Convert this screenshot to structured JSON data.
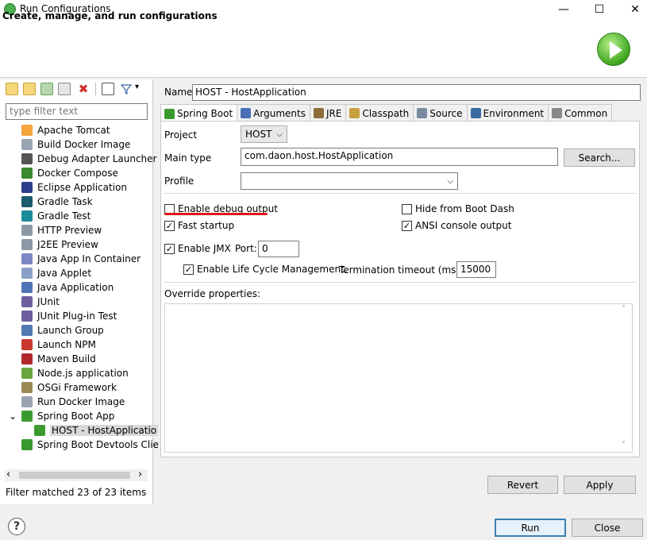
{
  "window": {
    "title": "Run Configurations",
    "minimize": "—",
    "maximize": "☐",
    "close": "✕"
  },
  "banner": {
    "title": "Create, manage, and run configurations"
  },
  "left": {
    "filter_placeholder": "type filter text",
    "items": [
      {
        "label": "Apache Tomcat",
        "color": "#f4a53b"
      },
      {
        "label": "Build Docker Image",
        "color": "#9aa4b2"
      },
      {
        "label": "Debug Adapter Launcher",
        "color": "#555555"
      },
      {
        "label": "Docker Compose",
        "color": "#3a8a2e"
      },
      {
        "label": "Eclipse Application",
        "color": "#2c3e8a"
      },
      {
        "label": "Gradle Task",
        "color": "#1d5b6d"
      },
      {
        "label": "Gradle Test",
        "color": "#1d8a9a"
      },
      {
        "label": "HTTP Preview",
        "color": "#8d99a6"
      },
      {
        "label": "J2EE Preview",
        "color": "#8d99a6"
      },
      {
        "label": "Java App In Container",
        "color": "#7b86c4"
      },
      {
        "label": "Java Applet",
        "color": "#8aa1c7"
      },
      {
        "label": "Java Application",
        "color": "#4f74b5"
      },
      {
        "label": "JUnit",
        "color": "#6d5f9e"
      },
      {
        "label": "JUnit Plug-in Test",
        "color": "#6d5f9e"
      },
      {
        "label": "Launch Group",
        "color": "#4f7bb0"
      },
      {
        "label": "Launch NPM",
        "color": "#c8382e"
      },
      {
        "label": "Maven Build",
        "color": "#b3282d"
      },
      {
        "label": "Node.js application",
        "color": "#6aa63c"
      },
      {
        "label": "OSGi Framework",
        "color": "#9a8a55"
      },
      {
        "label": "Run Docker Image",
        "color": "#9aa4b2"
      },
      {
        "label": "Spring Boot App",
        "color": "#3a9a2e"
      },
      {
        "label": "HOST - HostApplicatio",
        "color": "#3a9a2e"
      },
      {
        "label": "Spring Boot Devtools Clie",
        "color": "#3a9a2e"
      }
    ],
    "expand_arrow": "⌄",
    "scroll_left": "‹",
    "scroll_right": "›",
    "filter_status": "Filter matched 23 of 23 items"
  },
  "config": {
    "name_label": "Name:",
    "name_value": "HOST - HostApplication",
    "tabs": [
      {
        "label": "Spring Boot",
        "color": "#3a9a2e"
      },
      {
        "label": "Arguments",
        "color": "#4a6fb5"
      },
      {
        "label": "JRE",
        "color": "#8a6d3b"
      },
      {
        "label": "Classpath",
        "color": "#c8a040"
      },
      {
        "label": "Source",
        "color": "#7a8aa0"
      },
      {
        "label": "Environment",
        "color": "#3a6aa0"
      },
      {
        "label": "Common",
        "color": "#888888"
      }
    ],
    "project_label": "Project",
    "project_value": "HOST",
    "main_type_label": "Main type",
    "main_type_value": "com.daon.host.HostApplication",
    "search_button": "Search...",
    "profile_label": "Profile",
    "profile_value": "",
    "dropdown_arrow": "⌵",
    "enable_debug_output": "Enable debug output",
    "hide_from_boot_dash": "Hide from Boot Dash",
    "fast_startup": "Fast startup",
    "ansi_console_output": "ANSI console output",
    "enable_jmx": "Enable JMX",
    "port_label": "Port:",
    "port_value": "0",
    "enable_lifecycle": "Enable Life Cycle Management.",
    "termination_timeout_label": "Termination timeout (ms):",
    "termination_timeout_value": "15000",
    "override_properties_label": "Override properties:",
    "checked_mark": "✓",
    "scroll_up": "˄",
    "scroll_down": "˅",
    "revert_button": "Revert",
    "apply_button": "Apply"
  },
  "footer": {
    "help": "?",
    "run_button": "Run",
    "close_button": "Close"
  }
}
